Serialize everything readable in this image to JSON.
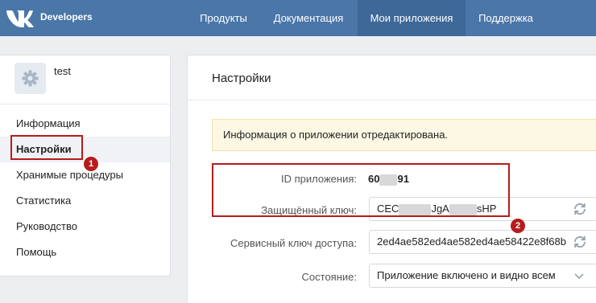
{
  "header": {
    "brand": "Developers",
    "nav": [
      {
        "label": "Продукты"
      },
      {
        "label": "Документация"
      },
      {
        "label": "Мои приложения"
      },
      {
        "label": "Поддержка"
      }
    ]
  },
  "app": {
    "name": "test"
  },
  "sidebar": {
    "items": [
      {
        "label": "Информация"
      },
      {
        "label": "Настройки"
      },
      {
        "label": "Хранимые процедуры"
      },
      {
        "label": "Статистика"
      },
      {
        "label": "Руководство"
      },
      {
        "label": "Помощь"
      }
    ]
  },
  "annotations": {
    "badge1": "1",
    "badge2": "2",
    "color": "#b71c1c"
  },
  "main": {
    "title": "Настройки",
    "notice": "Информация о приложении отредактирована.",
    "fields": {
      "app_id_label": "ID приложения:",
      "app_id_prefix": "60",
      "app_id_suffix": "91",
      "secret_label": "Защищённый ключ:",
      "secret_part1": "CEC",
      "secret_part2": "JgA",
      "secret_part3": "sHP",
      "service_label": "Сервисный ключ доступа:",
      "service_value": "2ed4ae582ed4ae582ed4ae58422e8f68b",
      "state_label": "Состояние:",
      "state_value": "Приложение включено и видно всем"
    }
  },
  "colors": {
    "header_bg": "#4a76a8",
    "nav_active_bg": "#3d6898",
    "notice_bg": "#fcf8e3",
    "page_bg": "#edeef0"
  }
}
